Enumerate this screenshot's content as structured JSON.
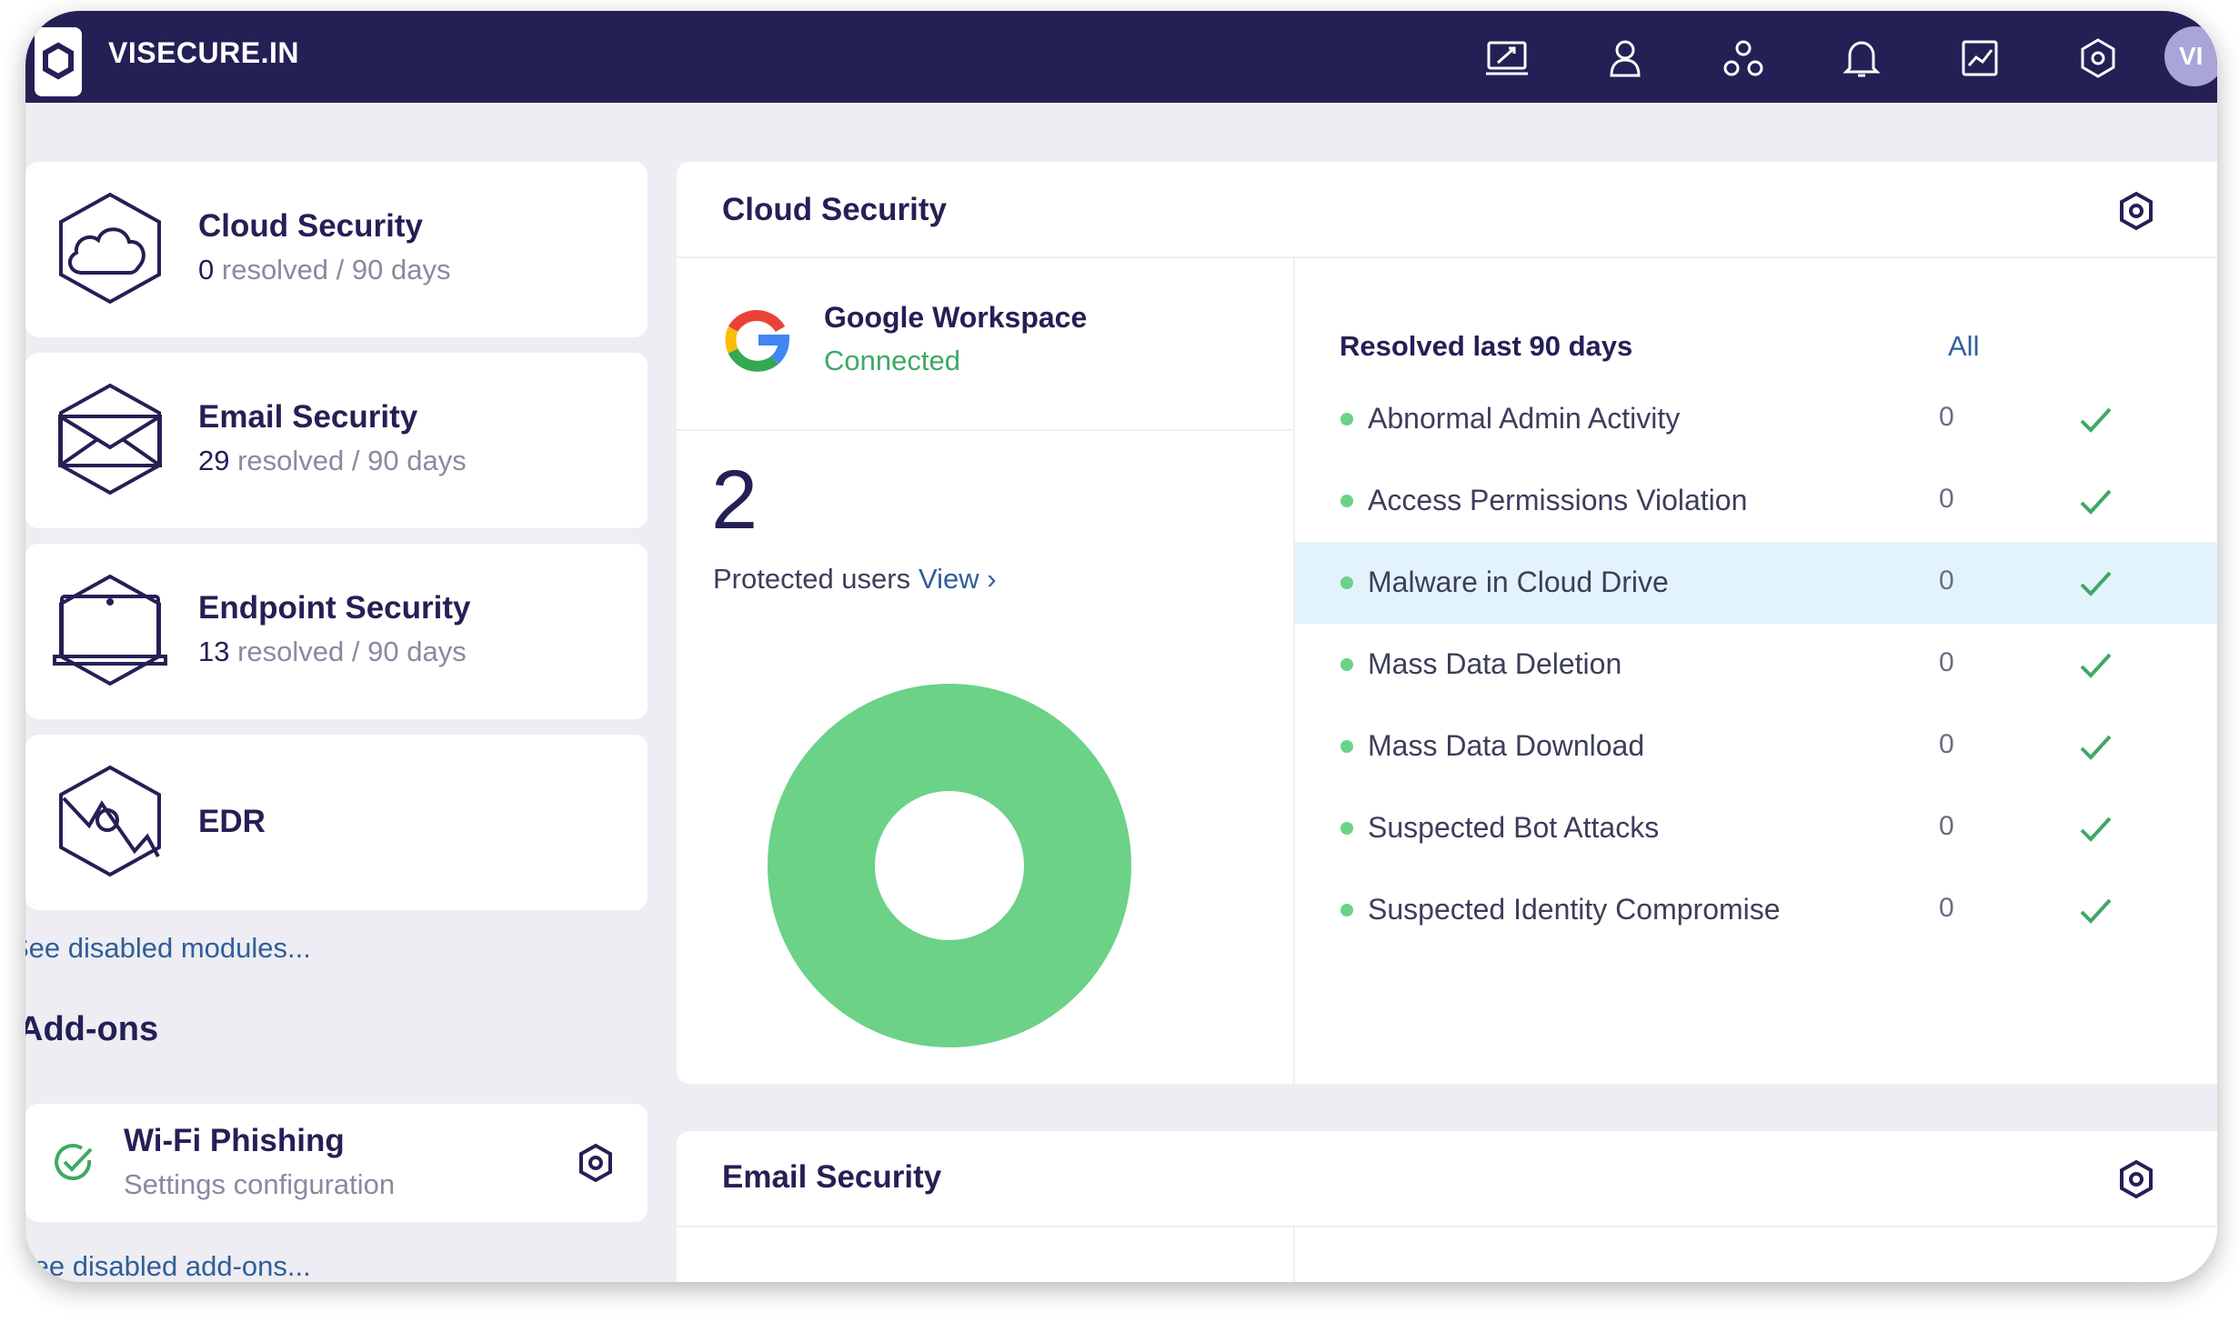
{
  "header": {
    "brand": "VISECURE.IN",
    "avatar_initials": "VI",
    "icons": [
      "monitor-icon",
      "user-icon",
      "group-icon",
      "bell-icon",
      "analytics-icon",
      "settings-icon"
    ]
  },
  "modules": [
    {
      "title": "Cloud Security",
      "resolved_count": "0",
      "resolved_suffix": "resolved / 90 days",
      "icon": "cloud-icon"
    },
    {
      "title": "Email Security",
      "resolved_count": "29",
      "resolved_suffix": "resolved / 90 days",
      "icon": "envelope-icon"
    },
    {
      "title": "Endpoint Security",
      "resolved_count": "13",
      "resolved_suffix": "resolved / 90 days",
      "icon": "laptop-icon"
    },
    {
      "title": "EDR",
      "icon": "edr-icon"
    }
  ],
  "disabled_modules_link": "See disabled modules...",
  "addons": {
    "heading": "Add-ons",
    "items": [
      {
        "title": "Wi-Fi Phishing",
        "subtitle": "Settings configuration"
      }
    ],
    "disabled_link": "See disabled add-ons..."
  },
  "cloud_panel": {
    "title": "Cloud Security",
    "integration": {
      "name": "Google Workspace",
      "status": "Connected"
    },
    "protected_users": {
      "count": "2",
      "label": "Protected users",
      "view_link": "View ›"
    },
    "resolved_header": "Resolved last 90 days",
    "all_link": "All",
    "rows": [
      {
        "label": "Abnormal Admin Activity",
        "count": "0"
      },
      {
        "label": "Access Permissions Violation",
        "count": "0"
      },
      {
        "label": "Malware in Cloud Drive",
        "count": "0",
        "highlighted": true
      },
      {
        "label": "Mass Data Deletion",
        "count": "0"
      },
      {
        "label": "Mass Data Download",
        "count": "0"
      },
      {
        "label": "Suspected Bot Attacks",
        "count": "0"
      },
      {
        "label": "Suspected Identity Compromise",
        "count": "0"
      }
    ]
  },
  "email_panel": {
    "title": "Email Security"
  },
  "colors": {
    "header_bg": "#242056",
    "accent_link": "#2f5f98",
    "status_green": "#6bd288",
    "connected_text": "#3fa866",
    "highlight_row": "#e3f3fb"
  }
}
